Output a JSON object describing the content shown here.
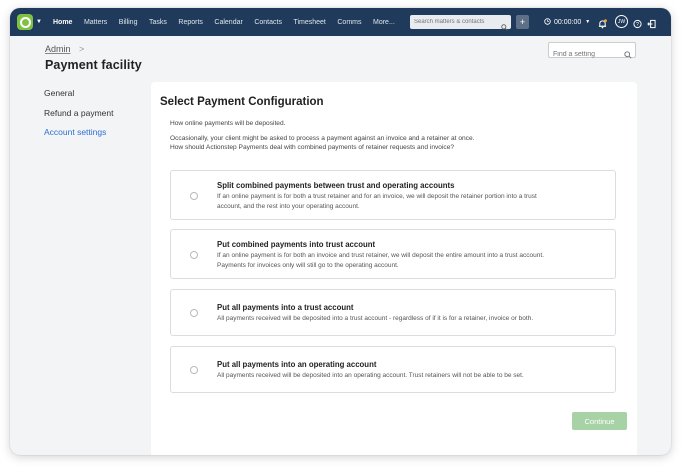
{
  "nav": {
    "items": [
      "Home",
      "Matters",
      "Billing",
      "Tasks",
      "Reports",
      "Calendar",
      "Contacts",
      "Timesheet",
      "Comms",
      "More..."
    ],
    "search_placeholder": "Search matters & contacts",
    "timer": "00:00:00",
    "avatar_initials": "JW"
  },
  "breadcrumb": {
    "parent": "Admin",
    "separator": ">"
  },
  "page_title": "Payment facility",
  "setting_search_placeholder": "Find a setting",
  "sidebar": {
    "items": [
      {
        "label": "General"
      },
      {
        "label": "Refund a payment"
      },
      {
        "label": "Account settings"
      }
    ]
  },
  "card": {
    "title": "Select Payment Configuration",
    "intro": "How online payments will be deposited.",
    "question_line1": "Occasionally, your client might be asked to process a payment against an invoice and a retainer at once.",
    "question_line2": "How should Actionstep Payments deal with combined payments of retainer requests and invoice?",
    "options": [
      {
        "title": "Split combined payments between trust and operating accounts",
        "desc1": "If an online payment is for both a trust retainer and for an invoice, we will deposit the retainer portion into a trust",
        "desc2": "account, and the rest into your operating account."
      },
      {
        "title": "Put combined payments into trust account",
        "desc1": "If an online payment is for both an invoice and trust retainer, we will deposit the entire amount into a trust account.",
        "desc2": "Payments for invoices only will still go to the operating account."
      },
      {
        "title": "Put all payments into a trust account",
        "desc1": "All payments received will be deposited into a trust account - regardless of if it is for a retainer, invoice or both."
      },
      {
        "title": "Put all payments into an operating account",
        "desc1": "All payments received will be deposited into an operating account. Trust retainers will not be able to be set."
      }
    ],
    "continue_label": "Continue"
  },
  "colors": {
    "nav_bg": "#1f3a5a",
    "logo_green": "#7fc242",
    "active_link": "#2f6fd1",
    "continue_disabled": "#a6d2a6"
  }
}
